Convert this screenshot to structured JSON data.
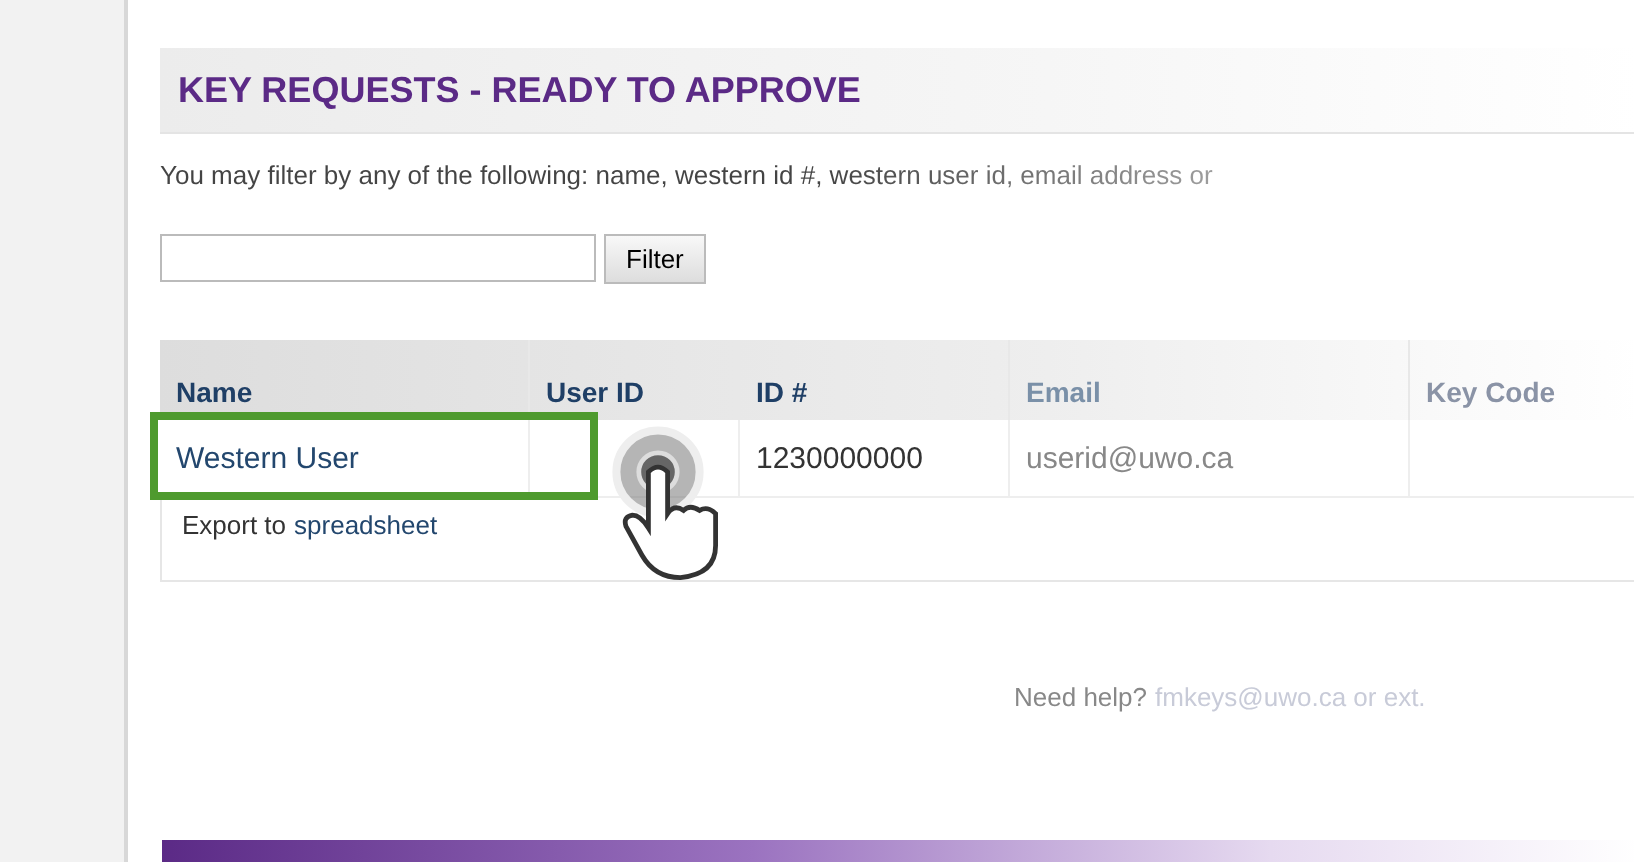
{
  "title": "KEY REQUESTS - READY TO APPROVE",
  "filter_hint": "You may filter by any of the following: name, western id #, western user id, email address or",
  "filter": {
    "button": "Filter"
  },
  "table": {
    "columns": [
      "Name",
      "User ID",
      "ID #",
      "Email",
      "Key Code"
    ],
    "rows": [
      {
        "name": "Western User",
        "id_number": "1230000000",
        "email": "userid@uwo.ca",
        "highlighted": true
      }
    ],
    "export": {
      "text": "Export to",
      "link": "spreadsheet"
    }
  },
  "help": {
    "text": "Need help?",
    "link": "fmkeys@uwo.ca or ext."
  }
}
